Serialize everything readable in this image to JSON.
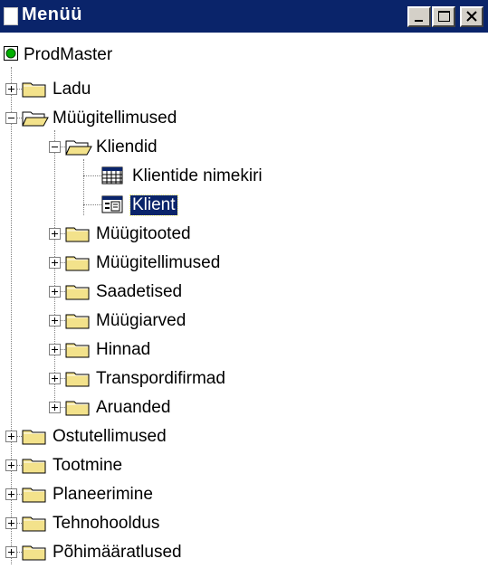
{
  "window": {
    "title": "Menüü",
    "minimize_label": "_",
    "maximize_label": "□",
    "close_label": "×"
  },
  "colors": {
    "titlebar": "#0a246a",
    "folder": "#f3e28b",
    "selection": "#0a246a",
    "root_icon_green": "#00b000"
  },
  "tree": {
    "root": {
      "label": "ProdMaster",
      "icon": "green-circle-icon"
    },
    "items": [
      {
        "label": "Ladu",
        "icon": "folder-closed-icon",
        "expander": "plus"
      },
      {
        "label": "Müügitellimused",
        "icon": "folder-open-icon",
        "expander": "minus"
      },
      {
        "label": "Kliendid",
        "icon": "folder-open-icon",
        "expander": "minus"
      },
      {
        "label": "Klientide nimekiri",
        "icon": "table-grid-icon",
        "expander": "none"
      },
      {
        "label": "Klient",
        "icon": "form-icon",
        "expander": "none",
        "selected": true
      },
      {
        "label": "Müügitooted",
        "icon": "folder-closed-icon",
        "expander": "plus"
      },
      {
        "label": "Müügitellimused",
        "icon": "folder-closed-icon",
        "expander": "plus"
      },
      {
        "label": "Saadetised",
        "icon": "folder-closed-icon",
        "expander": "plus"
      },
      {
        "label": "Müügiarved",
        "icon": "folder-closed-icon",
        "expander": "plus"
      },
      {
        "label": "Hinnad",
        "icon": "folder-closed-icon",
        "expander": "plus"
      },
      {
        "label": "Transpordifirmad",
        "icon": "folder-closed-icon",
        "expander": "plus"
      },
      {
        "label": "Aruanded",
        "icon": "folder-closed-icon",
        "expander": "plus"
      },
      {
        "label": "Ostutellimused",
        "icon": "folder-closed-icon",
        "expander": "plus"
      },
      {
        "label": "Tootmine",
        "icon": "folder-closed-icon",
        "expander": "plus"
      },
      {
        "label": "Planeerimine",
        "icon": "folder-closed-icon",
        "expander": "plus"
      },
      {
        "label": "Tehnohooldus",
        "icon": "folder-closed-icon",
        "expander": "plus"
      },
      {
        "label": "Põhimääratlused",
        "icon": "folder-closed-icon",
        "expander": "plus"
      }
    ]
  }
}
